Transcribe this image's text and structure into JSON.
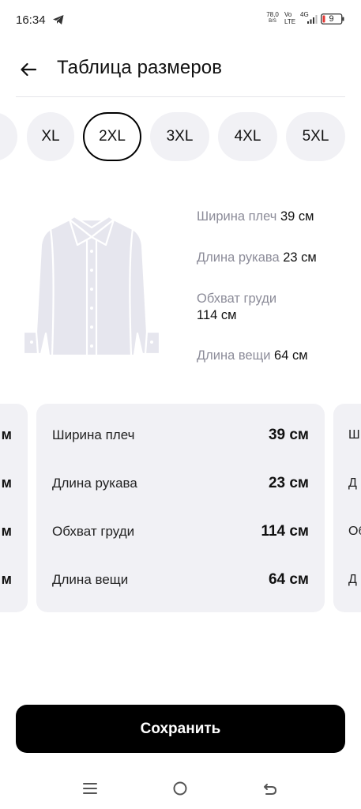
{
  "status_bar": {
    "time": "16:34",
    "net_speed_value": "78,0",
    "net_speed_unit": "B/S",
    "volte_top": "Vo",
    "volte_bottom": "LTE",
    "network_type": "4G",
    "battery_level": "9"
  },
  "header": {
    "back_icon": "arrow-left-icon",
    "title": "Таблица размеров"
  },
  "sizes": {
    "selected": "2XL",
    "chips": [
      "",
      "XL",
      "2XL",
      "3XL",
      "4XL",
      "5XL"
    ]
  },
  "illustration": {
    "icon": "shirt-icon",
    "measurements": [
      {
        "label": "Ширина плеч",
        "value": "39 см"
      },
      {
        "label": "Длина рукава",
        "value": "23 см"
      },
      {
        "label": "Обхват груди",
        "value": "114 см"
      },
      {
        "label": "Длина вещи",
        "value": "64 см"
      }
    ]
  },
  "cards": {
    "left_edge": [
      "м",
      "м",
      "м",
      "м"
    ],
    "center_rows": [
      {
        "label": "Ширина плеч",
        "value": "39 см"
      },
      {
        "label": "Длина рукава",
        "value": "23 см"
      },
      {
        "label": "Обхват груди",
        "value": "114 см"
      },
      {
        "label": "Длина вещи",
        "value": "64 см"
      }
    ],
    "right_edge": [
      "Ш",
      "Д",
      "Об",
      "Д"
    ]
  },
  "save_button": {
    "label": "Сохранить"
  },
  "navbar": {
    "menu_icon": "menu-icon",
    "home_icon": "home-circle-icon",
    "back_icon": "back-arrow-icon"
  },
  "colors": {
    "accent": "#000000",
    "chip_bg": "#f1f1f5",
    "muted_text": "#8c8c99"
  }
}
